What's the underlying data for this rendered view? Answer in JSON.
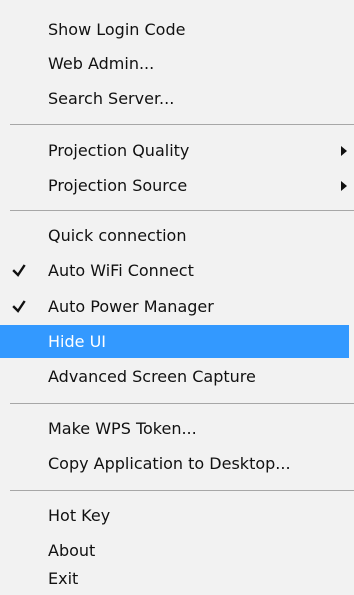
{
  "menu": {
    "items": [
      {
        "label": "Show Login Code"
      },
      {
        "label": "Web Admin..."
      },
      {
        "label": "Search Server..."
      },
      {
        "label": "Projection Quality"
      },
      {
        "label": "Projection Source"
      },
      {
        "label": "Quick connection"
      },
      {
        "label": "Auto WiFi Connect",
        "checked": true
      },
      {
        "label": "Auto Power Manager",
        "checked": true
      },
      {
        "label": "Hide UI",
        "highlighted": true
      },
      {
        "label": "Advanced Screen Capture"
      },
      {
        "label": "Make WPS Token..."
      },
      {
        "label": "Copy Application to Desktop..."
      },
      {
        "label": "Hot Key"
      },
      {
        "label": "About"
      },
      {
        "label": "Exit"
      }
    ]
  },
  "colors": {
    "menu_background": "#f2f2f2",
    "highlight_background": "#3399ff",
    "highlight_text": "#ffffff",
    "separator": "#a7a7a7",
    "text": "#111111"
  },
  "icons": {
    "check": "checkmark-icon",
    "submenu": "submenu-arrow-icon"
  }
}
